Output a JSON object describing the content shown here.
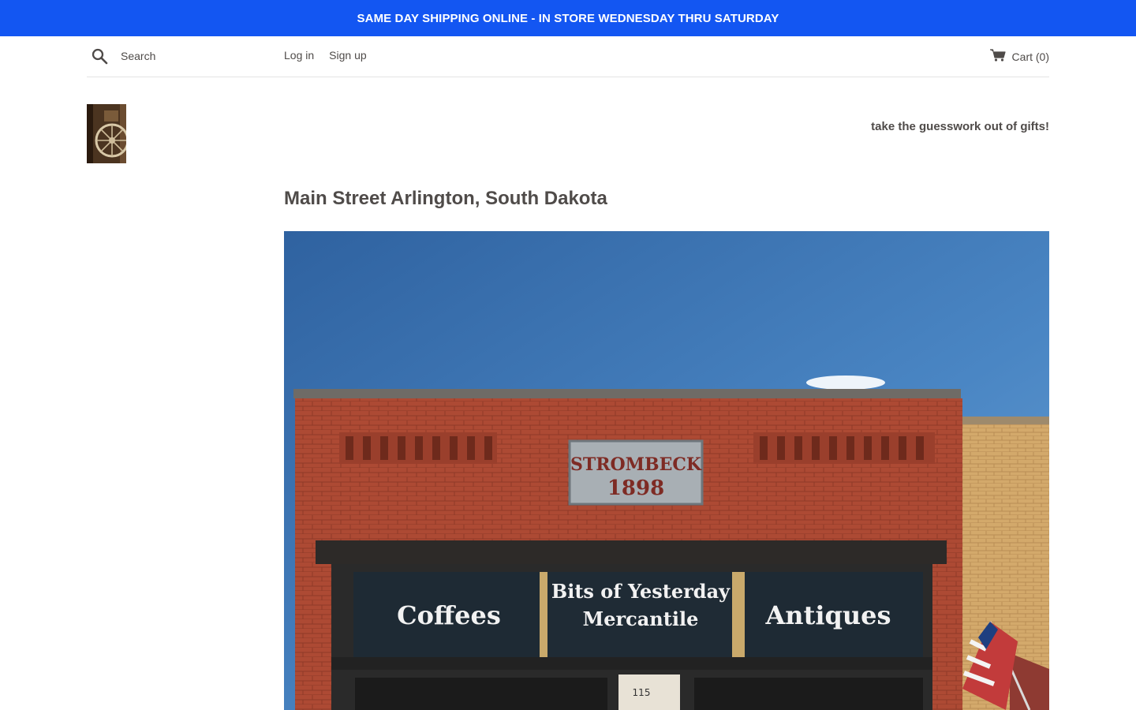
{
  "announcement": {
    "text": "SAME DAY SHIPPING ONLINE - IN STORE WEDNESDAY THRU SATURDAY"
  },
  "header": {
    "search": {
      "placeholder": "Search"
    },
    "account": {
      "login": "Log in",
      "signup": "Sign up"
    },
    "cart": {
      "label": "Cart (0)"
    }
  },
  "site": {
    "tagline": "take the guesswork out of gifts!"
  },
  "page": {
    "title": "Main Street Arlington, South Dakota"
  },
  "storefront": {
    "sign_name": "STROMBECK",
    "sign_year": "1898",
    "window_left": "Coffees",
    "window_center_line1": "Bits of Yesterday",
    "window_center_line2": "Mercantile",
    "window_right": "Antiques",
    "address_number": "115"
  },
  "colors": {
    "announcement_bg": "#1356f2",
    "text": "#4f4b49",
    "brick": "#b04a33",
    "sky": "#3f78b5"
  }
}
